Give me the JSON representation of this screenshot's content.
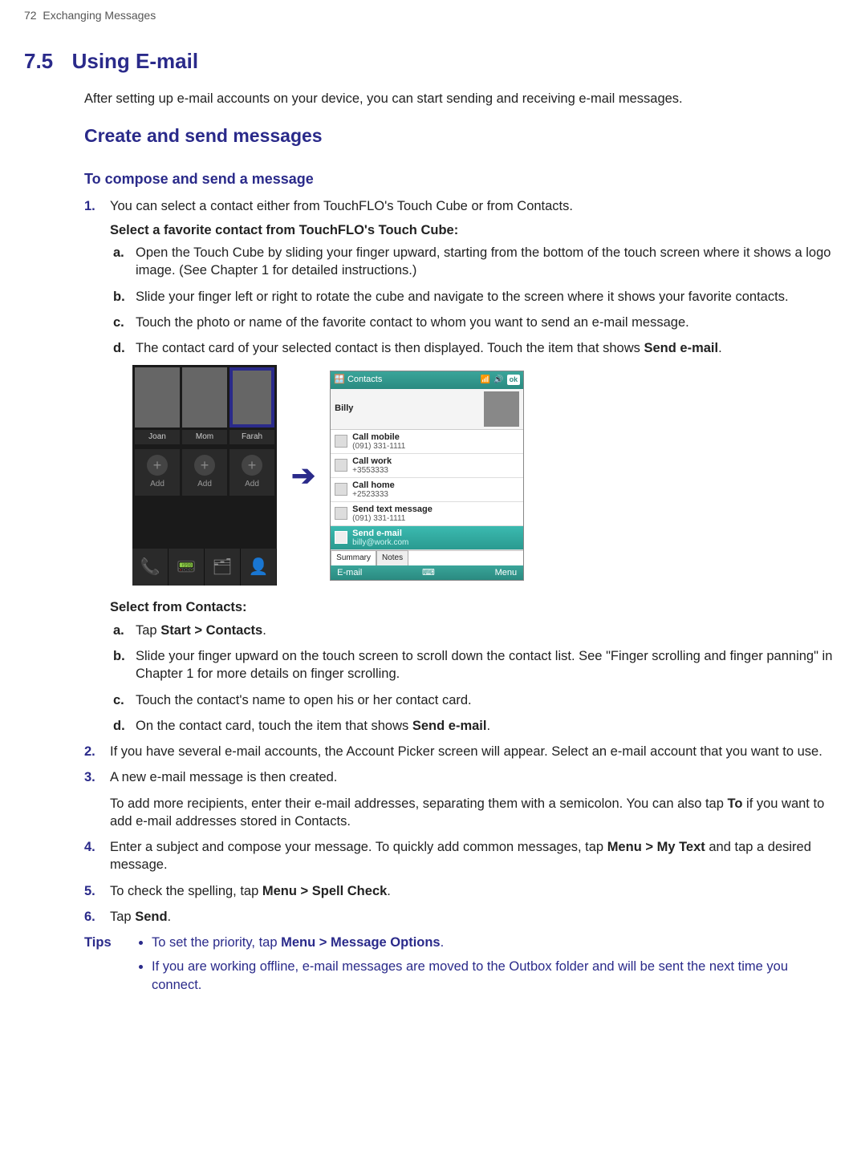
{
  "page": {
    "number": "72",
    "header": "Exchanging Messages"
  },
  "section": {
    "number": "7.5",
    "title": "Using E-mail"
  },
  "intro": "After setting up e-mail accounts on your device, you can start sending and receiving e-mail messages.",
  "h2": "Create and send messages",
  "h3": "To compose and send a message",
  "step1": {
    "num": "1.",
    "text": "You can select a contact either from TouchFLO's Touch Cube or from Contacts.",
    "selA_title": "Select a favorite contact from TouchFLO's Touch Cube:",
    "a": {
      "alpha": "a.",
      "text": "Open the Touch Cube by sliding your finger upward, starting from the bottom of the touch screen where it shows a logo image. (See Chapter 1 for detailed instructions.)"
    },
    "b": {
      "alpha": "b.",
      "text": "Slide your finger left or right to rotate the cube and navigate to the screen where it shows your favorite contacts."
    },
    "c": {
      "alpha": "c.",
      "text": "Touch the photo or name of the favorite contact to whom you want to send an e-mail message."
    },
    "d": {
      "alpha": "d.",
      "pre": "The contact card of your selected contact is then displayed. Touch the item that shows ",
      "bold": "Send e-mail",
      "post": "."
    },
    "selB_title": "Select from Contacts:",
    "ba": {
      "alpha": "a.",
      "pre": "Tap ",
      "bold": "Start > Contacts",
      "post": "."
    },
    "bb": {
      "alpha": "b.",
      "text": "Slide your finger upward on the touch screen to scroll down the contact list. See \"Finger scrolling and finger panning\" in Chapter 1 for more details on finger scrolling."
    },
    "bc": {
      "alpha": "c.",
      "text": "Touch the contact's name to open his or her contact card."
    },
    "bd": {
      "alpha": "d.",
      "pre": "On the contact card, touch the item that shows ",
      "bold": "Send e-mail",
      "post": "."
    }
  },
  "step2": {
    "num": "2.",
    "text": "If you have several e-mail accounts, the Account Picker screen will appear. Select an e-mail account that you want to use."
  },
  "step3": {
    "num": "3.",
    "text1": "A new e-mail message is then created.",
    "text2_pre": "To add more recipients, enter their e-mail addresses, separating them with a semicolon. You can also tap ",
    "text2_bold": "To",
    "text2_post": " if you want to add e-mail addresses stored in Contacts."
  },
  "step4": {
    "num": "4.",
    "pre": "Enter a subject and compose your message. To quickly add common messages, tap ",
    "bold": "Menu > My Text",
    "post": " and tap a desired message."
  },
  "step5": {
    "num": "5.",
    "pre": "To check the spelling, tap ",
    "bold": "Menu > Spell Check",
    "post": "."
  },
  "step6": {
    "num": "6.",
    "pre": "Tap ",
    "bold": "Send",
    "post": "."
  },
  "tips": {
    "label": "Tips",
    "items": [
      {
        "pre": "To set the priority, tap ",
        "bold": "Menu > Message Options",
        "post": "."
      },
      {
        "text": "If you are working offline, e-mail messages are moved to the Outbox folder and will be sent the next time you connect."
      }
    ]
  },
  "touchcube": {
    "names": [
      "Joan",
      "Mom",
      "Farah"
    ],
    "add": "Add"
  },
  "contacts": {
    "title": "Contacts",
    "ok": "ok",
    "person": "Billy",
    "items": [
      {
        "main": "Call mobile",
        "sub": "(091) 331-1111"
      },
      {
        "main": "Call work",
        "sub": "+3553333"
      },
      {
        "main": "Call home",
        "sub": "+2523333"
      },
      {
        "main": "Send text message",
        "sub": "(091) 331-1111"
      },
      {
        "main": "Send e-mail",
        "sub": "billy@work.com"
      }
    ],
    "tabs": [
      "Summary",
      "Notes"
    ],
    "menu_left": "E-mail",
    "menu_right": "Menu"
  }
}
